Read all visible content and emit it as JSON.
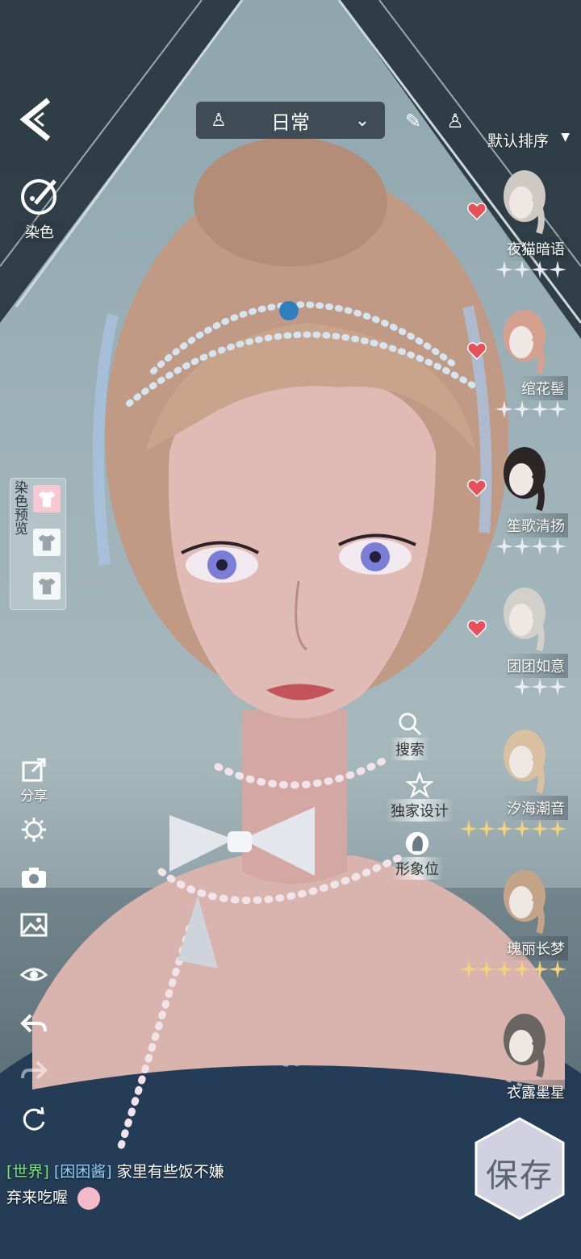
{
  "header": {
    "category_label": "日常",
    "sort_label": "默认排序"
  },
  "left_panel": {
    "dye_label": "染色",
    "dye_preview_title": "染色预览",
    "share_label": "分享"
  },
  "side_actions": {
    "search_label": "搜索",
    "exclusive_label": "独家设计",
    "image_slot_label": "形象位"
  },
  "hair_list": [
    {
      "name": "夜猫暗语",
      "stars": 4,
      "favorited": true
    },
    {
      "name": "绾花髻",
      "stars": 4,
      "favorited": true
    },
    {
      "name": "笙歌清扬",
      "stars": 4,
      "favorited": true
    },
    {
      "name": "团团如意",
      "stars": 3,
      "favorited": true
    },
    {
      "name": "汐海潮音",
      "stars": 6,
      "favorited": false
    },
    {
      "name": "瑰丽长梦",
      "stars": 6,
      "favorited": false
    },
    {
      "name": "衣露墨星",
      "stars": 0,
      "favorited": false
    }
  ],
  "chat": {
    "channel": "[世界]",
    "user": "[困困酱]",
    "message_line1": "家里有些饭不嫌",
    "message_line2": "弃来吃喔"
  },
  "save_label": "保存",
  "colors": {
    "heart": "#e8505b",
    "gold_star": "#f3d27a",
    "silver_star": "#e8ecf0"
  }
}
